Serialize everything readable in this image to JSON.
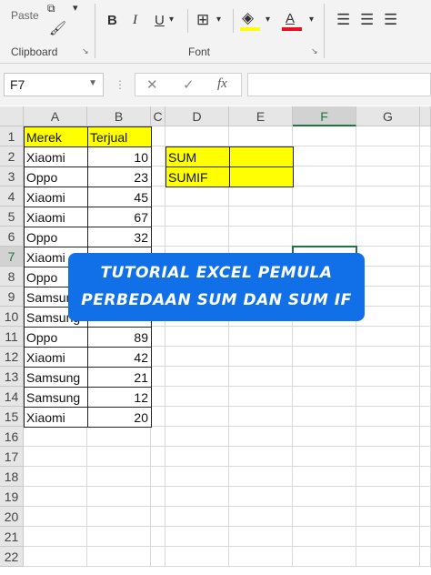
{
  "ribbon": {
    "paste_label": "Paste",
    "clipboard_label": "Clipboard",
    "font_label": "Font",
    "bold": "B",
    "italic": "I",
    "underline": "U",
    "underline_dd": "▾",
    "font_color_letter": "A",
    "colors": {
      "fill": "#ffff00",
      "font": "#e81123"
    }
  },
  "formula_bar": {
    "name_box": "F7",
    "cancel_icon": "✕",
    "enter_icon": "✓",
    "fx_label": "fx",
    "formula": ""
  },
  "columns": [
    "A",
    "B",
    "C",
    "D",
    "E",
    "F",
    "G"
  ],
  "selected_column": "F",
  "rows": [
    "1",
    "2",
    "3",
    "4",
    "5",
    "6",
    "7",
    "8",
    "9",
    "10",
    "11",
    "12",
    "13",
    "14",
    "15",
    "16",
    "17",
    "18",
    "19",
    "20",
    "21",
    "22"
  ],
  "selected_row": "7",
  "table": {
    "header": [
      "Merek",
      "Terjual"
    ],
    "merek": [
      "Xiaomi",
      "Oppo",
      "Xiaomi",
      "Xiaomi",
      "Oppo",
      "Xiaomi",
      "Oppo",
      "Samsung",
      "Samsung",
      "Oppo",
      "Xiaomi",
      "Samsung",
      "Samsung",
      "Xiaomi"
    ],
    "terjual": [
      "10",
      "23",
      "45",
      "67",
      "32",
      "",
      "",
      "",
      "",
      "89",
      "42",
      "21",
      "12",
      "20"
    ]
  },
  "summary": {
    "sum_label": "SUM",
    "sumif_label": "SUMIF",
    "sum_value": "",
    "sumif_value": ""
  },
  "banner": {
    "line1": "TUTORIAL EXCEL PEMULA",
    "line2": "PERBEDAAN SUM DAN SUM IF"
  }
}
